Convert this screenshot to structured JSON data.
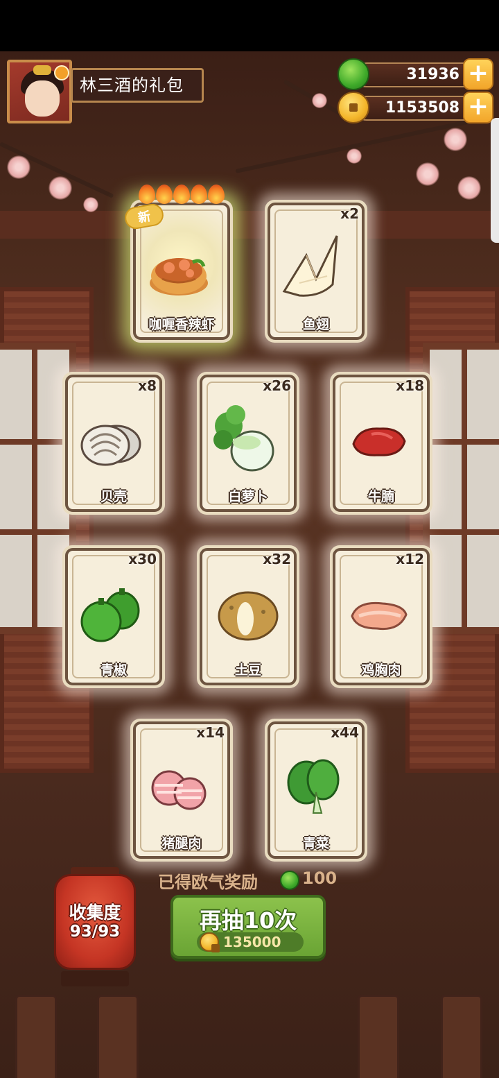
{
  "header": {
    "profile_title": "林三酒的礼包",
    "jade_amount": "31936",
    "coin_amount": "1153508"
  },
  "cards": [
    {
      "label": "咖喱香辣虾",
      "count": "",
      "new_tag": "新",
      "stars": 5,
      "icon": "curry-shrimp-icon"
    },
    {
      "label": "鱼翅",
      "count": "x2",
      "icon": "shark-fin-icon"
    },
    {
      "label": "贝壳",
      "count": "x8",
      "icon": "clam-icon"
    },
    {
      "label": "白萝卜",
      "count": "x26",
      "icon": "radish-icon"
    },
    {
      "label": "牛腩",
      "count": "x18",
      "icon": "beef-icon"
    },
    {
      "label": "青椒",
      "count": "x30",
      "icon": "green-pepper-icon"
    },
    {
      "label": "土豆",
      "count": "x32",
      "icon": "potato-icon"
    },
    {
      "label": "鸡胸肉",
      "count": "x12",
      "icon": "chicken-breast-icon"
    },
    {
      "label": "猪腿肉",
      "count": "x14",
      "icon": "pork-icon"
    },
    {
      "label": "青菜",
      "count": "x44",
      "icon": "bok-choy-icon"
    }
  ],
  "reward": {
    "label": "已得欧气奖励",
    "amount": "100"
  },
  "collection": {
    "label": "收集度",
    "value": "93/93"
  },
  "draw_button": {
    "label": "再抽10次",
    "cost": "135000"
  },
  "colors": {
    "jade": "#3faa2a",
    "coin": "#f3b52a",
    "button_green": "#7ab33e",
    "lantern_red": "#c53524"
  }
}
